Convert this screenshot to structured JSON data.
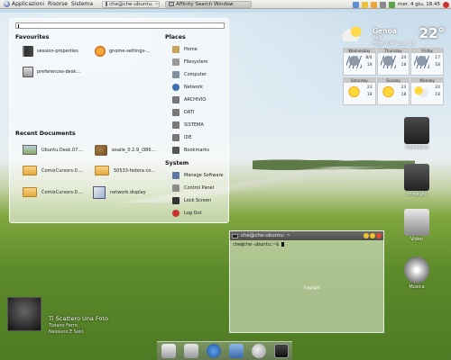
{
  "top_panel": {
    "menus": [
      "Applicazioni",
      "Risorse",
      "Sistema"
    ],
    "tasks": [
      "che@che-ubuntu: ~",
      "Affinity Search Window"
    ],
    "clock": "mer. 4 giu, 18.45"
  },
  "menu": {
    "search": {
      "value": ""
    },
    "favourites": {
      "heading": "Favourites",
      "items": [
        {
          "label": "session-properties",
          "icon": "book-icon"
        },
        {
          "label": "gnome-settings-...",
          "icon": "star-icon"
        },
        {
          "label": "preferences-desk...",
          "icon": "preferences-icon"
        }
      ]
    },
    "recent": {
      "heading": "Recent Documents",
      "items": [
        {
          "label": "Ubuntu.Desk.07....",
          "icon": "image-thumb-icon"
        },
        {
          "label": "exaile_0.2.9_i386....",
          "icon": "package-icon"
        },
        {
          "label": "ComixCursors-0....",
          "icon": "folder-icon"
        },
        {
          "label": "50533-fedora co...",
          "icon": "folder-icon"
        },
        {
          "label": "ComixCursors-0....",
          "icon": "folder-icon"
        },
        {
          "label": "network.display",
          "icon": "document-icon"
        }
      ]
    },
    "places": {
      "heading": "Places",
      "items": [
        "Home",
        "Filesystem",
        "Computer",
        "Network",
        "ARCHIVIO",
        "DATI",
        "SISTEMA",
        "IDE",
        "Bookmarks"
      ]
    },
    "system": {
      "heading": "System",
      "items": [
        "Manage Software",
        "Control Panel",
        "Lock Screen",
        "Log Out"
      ]
    }
  },
  "weather": {
    "city": "Genoa",
    "country": "Italy",
    "temperature": "22°",
    "high_low": "High: N/A°   Low: 18",
    "days": [
      {
        "day": "Wednesday",
        "max": "8/4",
        "min": "18",
        "icon": "rain"
      },
      {
        "day": "Thursday",
        "max": "24",
        "min": "18",
        "icon": "rain"
      },
      {
        "day": "Friday",
        "max": "17",
        "min": "18",
        "icon": "rain"
      },
      {
        "day": "Saturday",
        "max": "23",
        "min": "18",
        "icon": "sunny"
      },
      {
        "day": "Sunday",
        "max": "23",
        "min": "18",
        "icon": "sunny"
      },
      {
        "day": "Monday",
        "max": "24",
        "min": "18",
        "icon": "partly"
      }
    ]
  },
  "dock": [
    "Download",
    "Immagini",
    "Video",
    "Musica"
  ],
  "terminal": {
    "title": "che@che-ubuntu: ~",
    "prompt": "che@che-ubuntu:~$ ",
    "logo_text": "fyaglight"
  },
  "now_playing": {
    "title": "Ti Scattero Una Foto",
    "artist": "Tiziano Ferro",
    "album": "Nessuno E Solo"
  },
  "colors": {
    "accent": "#6b8bc2",
    "panel": "#e8e8e4"
  }
}
